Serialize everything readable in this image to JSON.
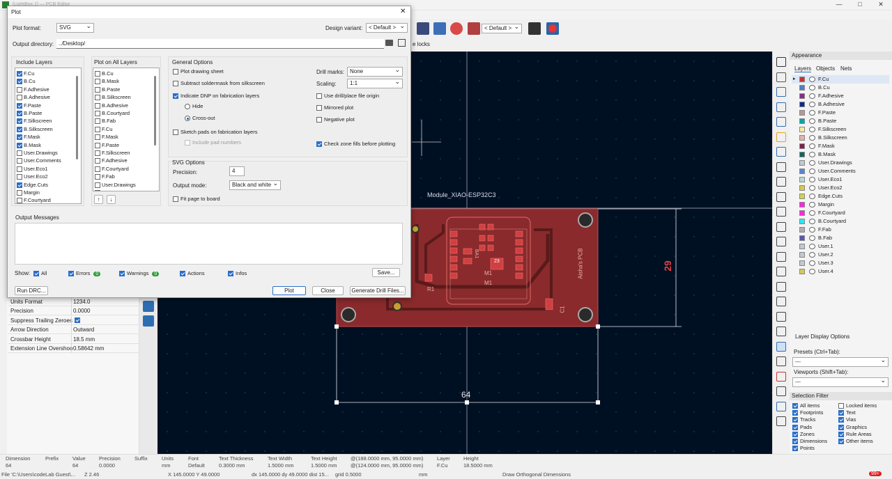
{
  "window": {
    "title": "[LightBox.1] — PCB Editor",
    "controls": [
      "—",
      "□",
      "✕"
    ]
  },
  "toolbar": {
    "variant": "< Default >"
  },
  "auxbar": {
    "locks_label": "e locks"
  },
  "dialog": {
    "title": "Plot",
    "close_glyph": "✕",
    "plot_format_label": "Plot format:",
    "plot_format_value": "SVG",
    "design_variant_label": "Design variant:",
    "design_variant_value": "< Default >",
    "output_dir_label": "Output directory:",
    "output_dir_value": "../Desktop/",
    "include_layers": {
      "title": "Include Layers",
      "items": [
        {
          "label": "F.Cu",
          "checked": true
        },
        {
          "label": "B.Cu",
          "checked": true
        },
        {
          "label": "F.Adhesive",
          "checked": false
        },
        {
          "label": "B.Adhesive",
          "checked": false
        },
        {
          "label": "F.Paste",
          "checked": true
        },
        {
          "label": "B.Paste",
          "checked": true
        },
        {
          "label": "F.Silkscreen",
          "checked": true
        },
        {
          "label": "B.Silkscreen",
          "checked": true
        },
        {
          "label": "F.Mask",
          "checked": true
        },
        {
          "label": "B.Mask",
          "checked": true
        },
        {
          "label": "User.Drawings",
          "checked": false
        },
        {
          "label": "User.Comments",
          "checked": false
        },
        {
          "label": "User.Eco1",
          "checked": false
        },
        {
          "label": "User.Eco2",
          "checked": false
        },
        {
          "label": "Edge.Cuts",
          "checked": true
        },
        {
          "label": "Margin",
          "checked": false
        },
        {
          "label": "F.Courtyard",
          "checked": false
        }
      ]
    },
    "plot_all_layers": {
      "title": "Plot on All Layers",
      "items": [
        {
          "label": "B.Cu",
          "checked": false
        },
        {
          "label": "B.Mask",
          "checked": false
        },
        {
          "label": "B.Paste",
          "checked": false
        },
        {
          "label": "B.Silkscreen",
          "checked": false
        },
        {
          "label": "B.Adhesive",
          "checked": false
        },
        {
          "label": "B.Courtyard",
          "checked": false
        },
        {
          "label": "B.Fab",
          "checked": false
        },
        {
          "label": "F.Cu",
          "checked": false
        },
        {
          "label": "F.Mask",
          "checked": false
        },
        {
          "label": "F.Paste",
          "checked": false
        },
        {
          "label": "F.Silkscreen",
          "checked": false
        },
        {
          "label": "F.Adhesive",
          "checked": false
        },
        {
          "label": "F.Courtyard",
          "checked": false
        },
        {
          "label": "F.Fab",
          "checked": false
        },
        {
          "label": "User.Drawings",
          "checked": false
        },
        {
          "label": "User.Comments",
          "checked": false
        }
      ],
      "up_glyph": "↑",
      "down_glyph": "↓"
    },
    "general": {
      "title": "General Options",
      "plot_drawing_sheet": {
        "label": "Plot drawing sheet",
        "checked": false
      },
      "subtract_soldermask": {
        "label": "Subtract soldermask from silkscreen",
        "checked": false
      },
      "indicate_dnp": {
        "label": "Indicate DNP on fabrication layers",
        "checked": true
      },
      "hide": {
        "label": "Hide",
        "selected": false
      },
      "crossout": {
        "label": "Cross-out",
        "selected": true
      },
      "sketch_pads": {
        "label": "Sketch pads on fabrication layers",
        "checked": false
      },
      "include_pad_numbers": {
        "label": "Include pad numbers",
        "checked": false
      },
      "drill_marks_label": "Drill marks:",
      "drill_marks_value": "None",
      "scaling_label": "Scaling:",
      "scaling_value": "1:1",
      "use_drill_origin": {
        "label": "Use drill/place file origin",
        "checked": false
      },
      "mirrored": {
        "label": "Mirrored plot",
        "checked": false
      },
      "negative": {
        "label": "Negative plot",
        "checked": false
      },
      "check_zone_fills": {
        "label": "Check zone fills before plotting",
        "checked": true
      }
    },
    "svg": {
      "title": "SVG Options",
      "precision_label": "Precision:",
      "precision_value": "4",
      "output_mode_label": "Output mode:",
      "output_mode_value": "Black and white",
      "fit_page": {
        "label": "Fit page to board",
        "checked": false
      }
    },
    "messages": {
      "title": "Output Messages",
      "show_label": "Show:",
      "filters": [
        {
          "label": "All",
          "checked": true
        },
        {
          "label": "Errors",
          "checked": true,
          "count": "0"
        },
        {
          "label": "Warnings",
          "checked": true,
          "count": "0"
        },
        {
          "label": "Actions",
          "checked": true
        },
        {
          "label": "Infos",
          "checked": true
        }
      ],
      "save_label": "Save..."
    },
    "buttons": {
      "run_drc": "Run DRC...",
      "plot": "Plot",
      "close": "Close",
      "generate_drill": "Generate Drill Files..."
    }
  },
  "properties": {
    "rows": [
      {
        "key": "Units Format",
        "value": "1234.0"
      },
      {
        "key": "Precision",
        "value": "0.0000"
      },
      {
        "key": "Suppress Trailing Zeroes",
        "value": "",
        "checked": true
      },
      {
        "key": "Arrow Direction",
        "value": "Outward"
      },
      {
        "key": "Crossbar Height",
        "value": "18.5 mm"
      },
      {
        "key": "Extension Line Overshoo",
        "value": "0.58642 mm"
      }
    ]
  },
  "canvas": {
    "module_label": "Module_XIAO-ESP32C3",
    "dim_vertical": "29",
    "dim_horizontal": "64",
    "silk_name": "Aisha's PCB",
    "ref_r1": "R1",
    "ref_c1": "C1",
    "ref_m1a": "M1",
    "ref_m1b": "M1",
    "ref_ba": "BA1",
    "chip_num": "23"
  },
  "appearance": {
    "title": "Appearance",
    "tabs": [
      "Layers",
      "Objects",
      "Nets"
    ],
    "layers": [
      {
        "name": "F.Cu",
        "color": "#c83434"
      },
      {
        "name": "B.Cu",
        "color": "#4d7fc4"
      },
      {
        "name": "F.Adhesive",
        "color": "#8a2b8a"
      },
      {
        "name": "B.Adhesive",
        "color": "#0f2a8a"
      },
      {
        "name": "F.Paste",
        "color": "#b49a96"
      },
      {
        "name": "B.Paste",
        "color": "#00a8a8"
      },
      {
        "name": "F.Silkscreen",
        "color": "#f2eda1"
      },
      {
        "name": "B.Silkscreen",
        "color": "#e8b2a7"
      },
      {
        "name": "F.Mask",
        "color": "#7e1f4e"
      },
      {
        "name": "B.Mask",
        "color": "#0a6a5a"
      },
      {
        "name": "User.Drawings",
        "color": "#c2c8cf"
      },
      {
        "name": "User.Comments",
        "color": "#5984d6"
      },
      {
        "name": "User.Eco1",
        "color": "#b4dbd2"
      },
      {
        "name": "User.Eco2",
        "color": "#d8c852"
      },
      {
        "name": "Edge.Cuts",
        "color": "#d0d250"
      },
      {
        "name": "Margin",
        "color": "#ff26e2"
      },
      {
        "name": "F.Courtyard",
        "color": "#ff26e2"
      },
      {
        "name": "B.Courtyard",
        "color": "#26e9ff"
      },
      {
        "name": "F.Fab",
        "color": "#afafaf"
      },
      {
        "name": "B.Fab",
        "color": "#5858ae"
      },
      {
        "name": "User.1",
        "color": "#c2c8cf"
      },
      {
        "name": "User.2",
        "color": "#c2c8cf"
      },
      {
        "name": "User.3",
        "color": "#c2c8cf"
      },
      {
        "name": "User.4",
        "color": "#d8c852"
      }
    ],
    "layer_display": "Layer Display Options",
    "presets_label": "Presets (Ctrl+Tab):",
    "presets_value": "---",
    "viewports_label": "Viewports (Shift+Tab):",
    "viewports_value": "---",
    "selection_filter": {
      "title": "Selection Filter",
      "items": [
        {
          "label": "All items",
          "checked": true
        },
        {
          "label": "Locked items",
          "checked": false
        },
        {
          "label": "Footprints",
          "checked": true
        },
        {
          "label": "Text",
          "checked": true
        },
        {
          "label": "Tracks",
          "checked": true
        },
        {
          "label": "Vias",
          "checked": true
        },
        {
          "label": "Pads",
          "checked": true
        },
        {
          "label": "Graphics",
          "checked": true
        },
        {
          "label": "Zones",
          "checked": true
        },
        {
          "label": "Rule Areas",
          "checked": true
        },
        {
          "label": "Dimensions",
          "checked": true
        },
        {
          "label": "Other items",
          "checked": true
        },
        {
          "label": "Points",
          "checked": true
        }
      ]
    }
  },
  "status": {
    "cols": [
      {
        "h": "Dimension",
        "v": "64"
      },
      {
        "h": "Prefix",
        "v": ""
      },
      {
        "h": "Value",
        "v": "64"
      },
      {
        "h": "Precision",
        "v": "0.0000"
      },
      {
        "h": "Suffix",
        "v": ""
      },
      {
        "h": "Units",
        "v": "mm"
      },
      {
        "h": "Font",
        "v": "Default"
      },
      {
        "h": "Text Thickness",
        "v": "0.3000 mm"
      },
      {
        "h": "Text Width",
        "v": "1.5000 mm"
      },
      {
        "h": "Text Height",
        "v": "1.5000 mm"
      },
      {
        "h": "@(188.0000 mm, 95.0000 mm)",
        "v": "@(124.0000 mm, 95.0000 mm)"
      },
      {
        "h": "Layer",
        "v": "F.Cu"
      },
      {
        "h": "Height",
        "v": "18.5000 mm"
      }
    ],
    "file": "File 'C:\\Users\\codeLab Guest\\...",
    "zoom": "Z 2.46",
    "xy": "X 145.0000  Y 49.0000",
    "dxdy": "dx 145.0000  dy 49.0000  dist 15...",
    "grid": "grid 0.5000",
    "units": "mm",
    "mode": "Draw Orthogonal Dimensions",
    "badge": "99+"
  }
}
